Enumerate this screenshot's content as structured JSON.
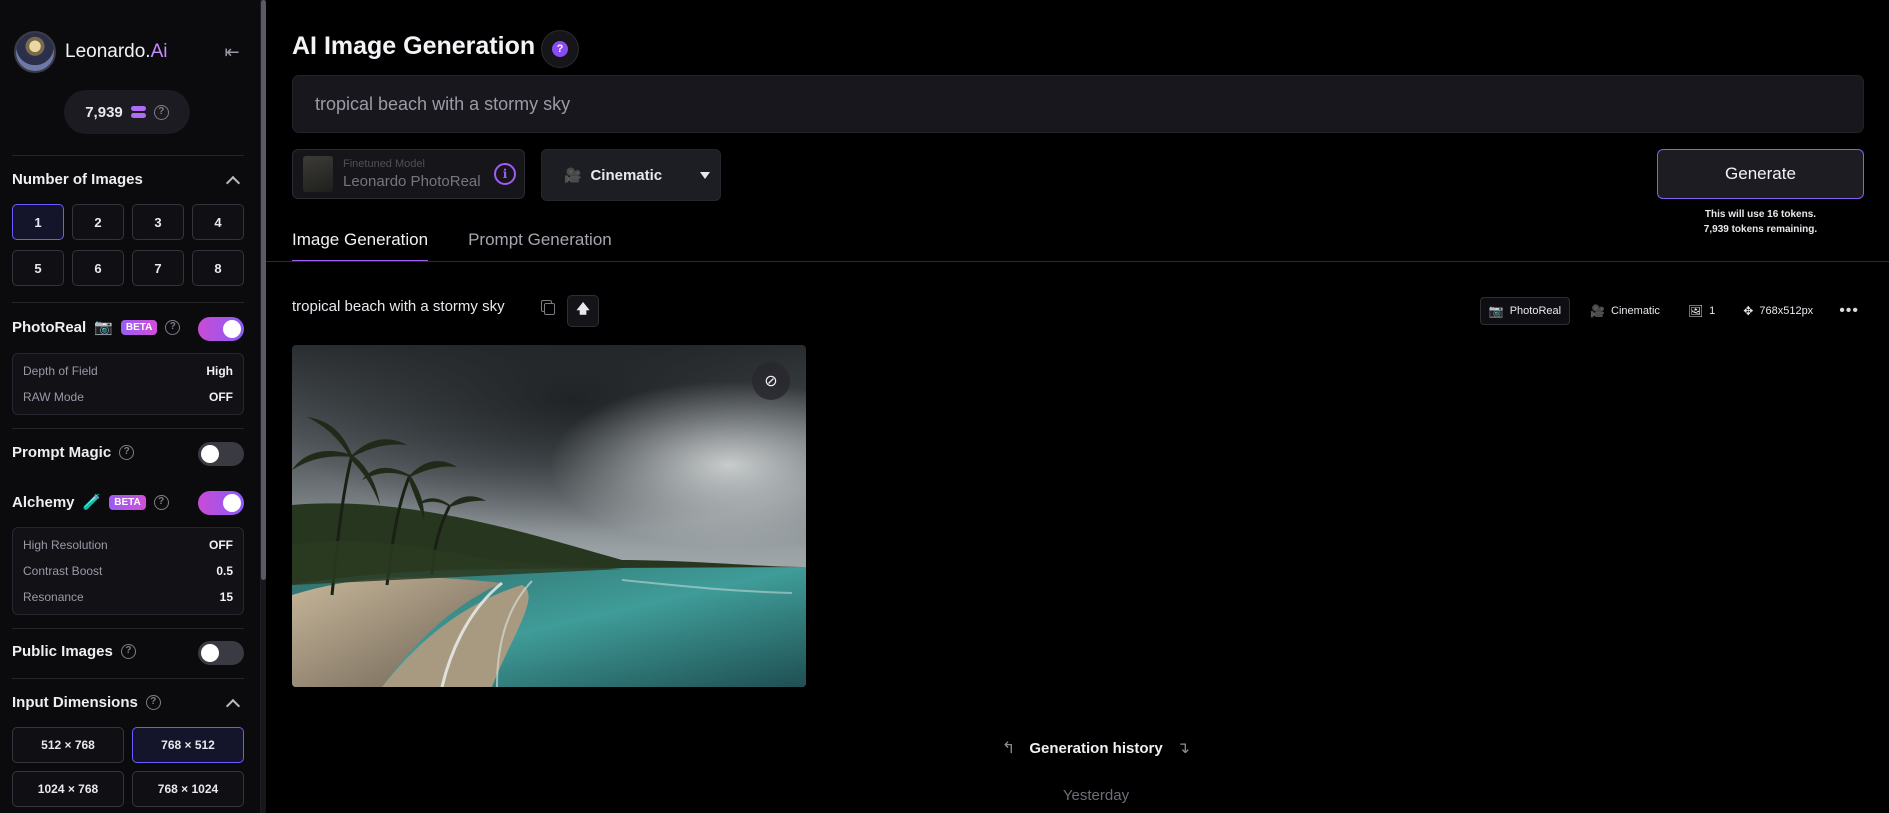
{
  "sidebar": {
    "brand_prefix": "Leonardo.",
    "brand_suffix": "Ai",
    "credits": "7,939",
    "number_of_images": {
      "title": "Number of Images",
      "options": [
        "1",
        "2",
        "3",
        "4",
        "5",
        "6",
        "7",
        "8"
      ],
      "selected": "1"
    },
    "photoreal": {
      "title": "PhotoReal",
      "badge": "BETA",
      "enabled": true,
      "options": [
        {
          "label": "Depth of Field",
          "value": "High"
        },
        {
          "label": "RAW Mode",
          "value": "OFF"
        }
      ]
    },
    "prompt_magic": {
      "title": "Prompt Magic",
      "enabled": false
    },
    "alchemy": {
      "title": "Alchemy",
      "badge": "BETA",
      "enabled": true,
      "options": [
        {
          "label": "High Resolution",
          "value": "OFF"
        },
        {
          "label": "Contrast Boost",
          "value": "0.5"
        },
        {
          "label": "Resonance",
          "value": "15"
        }
      ]
    },
    "public_images": {
      "title": "Public Images",
      "enabled": false
    },
    "input_dimensions": {
      "title": "Input Dimensions",
      "options": [
        "512 × 768",
        "768 × 512",
        "1024 × 768",
        "768 × 1024"
      ],
      "selected": "768 × 512"
    }
  },
  "main": {
    "page_title": "AI Image Generation",
    "prompt_placeholder": "tropical beach with a stormy sky",
    "model": {
      "sublabel": "Finetuned Model",
      "name": "Leonardo PhotoReal"
    },
    "style": "Cinematic",
    "generate_label": "Generate",
    "token_line1": "This will use 16 tokens.",
    "token_line2": "7,939 tokens remaining.",
    "tabs": [
      {
        "label": "Image Generation",
        "active": true
      },
      {
        "label": "Prompt Generation",
        "active": false
      }
    ],
    "generation": {
      "prompt": "tropical beach with a stormy sky",
      "tags": {
        "model": "PhotoReal",
        "style": "Cinematic",
        "count": "1",
        "size": "768x512px"
      }
    },
    "history_label": "Generation history",
    "history_group": "Yesterday"
  },
  "icons": {
    "collapse": "collapse-sidebar-icon",
    "help": "question-circle-icon",
    "info": "info-circle-icon",
    "hide": "eye-off-icon",
    "copy": "copy-icon",
    "upload": "arrow-up-icon",
    "more": "more-dots-icon"
  },
  "colors": {
    "accent": "#a25cf4",
    "toggle_on": "#c84bd6",
    "background": "#000000"
  }
}
